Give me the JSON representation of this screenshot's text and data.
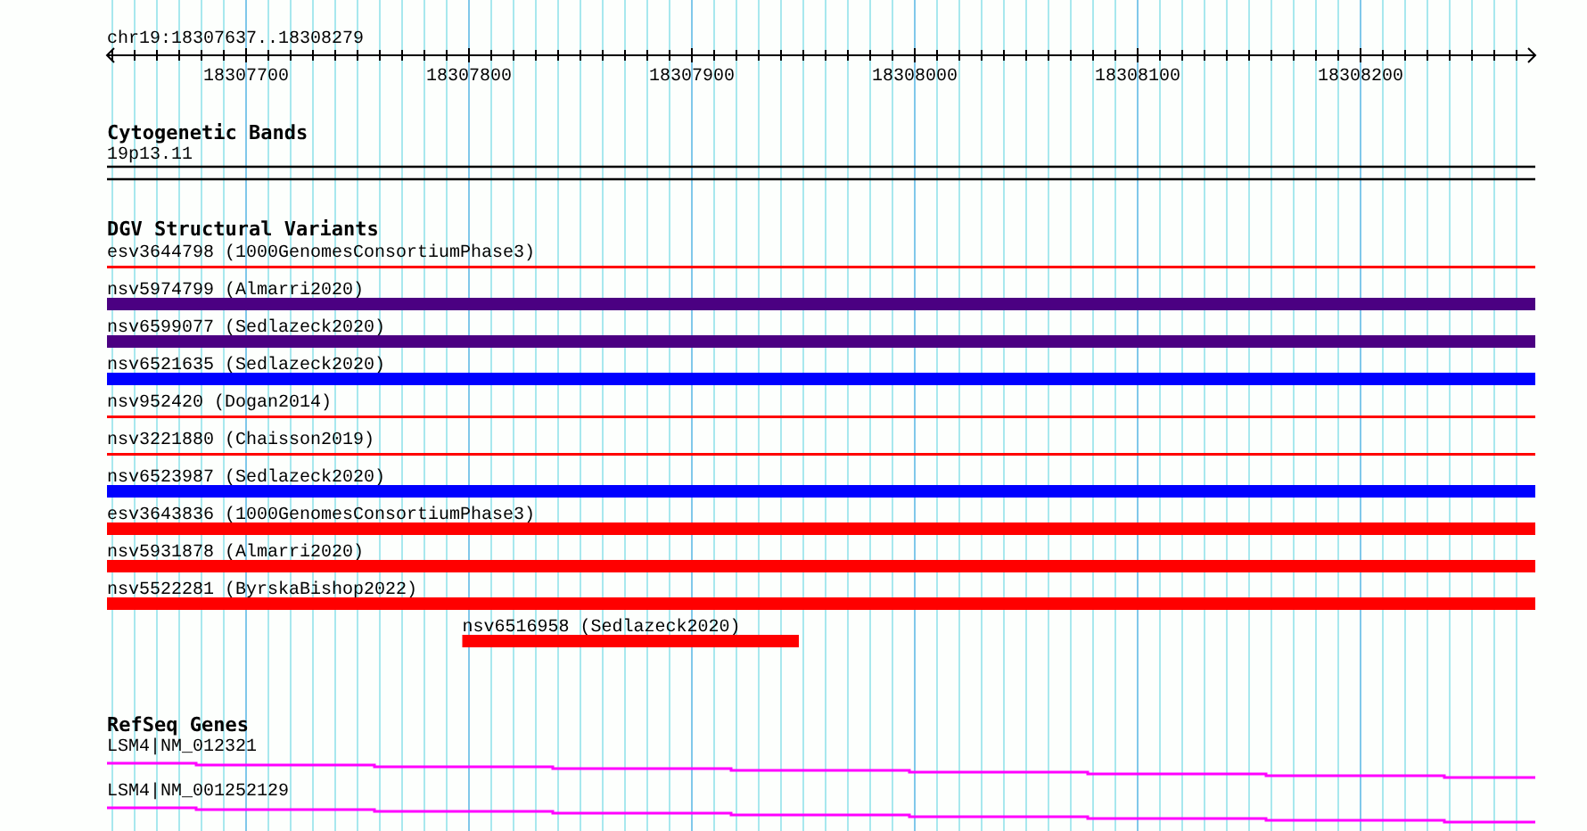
{
  "ruler": {
    "region": "chr19:18307637..18308279",
    "ticks": [
      "18307700",
      "18307800",
      "18307900",
      "18308000",
      "18308100",
      "18308200"
    ]
  },
  "tracks": [
    {
      "title": "Cytogenetic Bands",
      "kind": "bands",
      "features": [
        {
          "label": "19p13.11"
        }
      ]
    },
    {
      "title": "DGV Structural Variants",
      "kind": "variants",
      "features": [
        {
          "label": "esv3644798 (1000GenomesConsortiumPhase3)",
          "kind": "line",
          "color": "#ff0000"
        },
        {
          "label": "nsv5974799 (Almarri2020)",
          "kind": "bar",
          "color": "#4b0082"
        },
        {
          "label": "nsv6599077 (Sedlazeck2020)",
          "kind": "bar",
          "color": "#4b0082"
        },
        {
          "label": "nsv6521635 (Sedlazeck2020)",
          "kind": "bar",
          "color": "#0000ff"
        },
        {
          "label": "nsv952420 (Dogan2014)",
          "kind": "line",
          "color": "#ff0000"
        },
        {
          "label": "nsv3221880 (Chaisson2019)",
          "kind": "line",
          "color": "#ff0000"
        },
        {
          "label": "nsv6523987 (Sedlazeck2020)",
          "kind": "bar",
          "color": "#0000ff"
        },
        {
          "label": "esv3643836 (1000GenomesConsortiumPhase3)",
          "kind": "bar",
          "color": "#ff0000"
        },
        {
          "label": "nsv5931878 (Almarri2020)",
          "kind": "bar",
          "color": "#ff0000"
        },
        {
          "label": "nsv5522281 (ByrskaBishop2022)",
          "kind": "bar",
          "color": "#ff0000"
        },
        {
          "label": "nsv6516958 (Sedlazeck2020)",
          "kind": "partial",
          "color": "#ff0000"
        }
      ]
    },
    {
      "title": "RefSeq Genes",
      "kind": "genes",
      "features": [
        {
          "label": "LSM4|NM_012321"
        },
        {
          "label": "LSM4|NM_001252129"
        }
      ]
    }
  ]
}
